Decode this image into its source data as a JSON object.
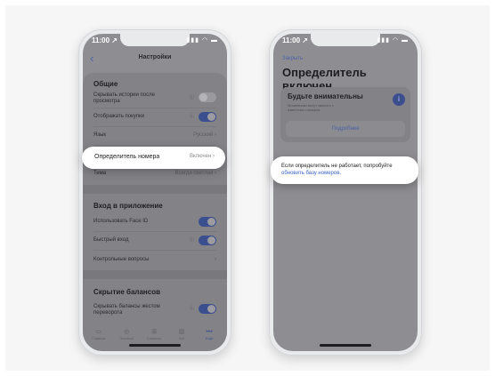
{
  "phone_left": {
    "status": {
      "time": "11:00 ↗",
      "icons": "▮▮▮ ◠ ▬"
    },
    "nav": {
      "back_icon": "chevron-left",
      "title": "Настройки"
    },
    "sections": {
      "general": {
        "title": "Общие",
        "hide_stories": "Скрывать истории после просмотра",
        "show_purchases": "Отображать покупки",
        "language_label": "Язык",
        "language_value": "Русский",
        "caller_id_label": "Определитель номера",
        "caller_id_value": "Включен",
        "theme_label": "Тема",
        "theme_value": "Всегда светлая"
      },
      "login": {
        "title": "Вход в приложение",
        "face_id": "Использовать Face ID",
        "quick_login": "Быстрый вход",
        "security_questions": "Контрольные вопросы"
      },
      "hidden_balances": {
        "title": "Скрытие балансов",
        "hide_by_flip": "Скрывать балансы жестом переворота"
      }
    },
    "toggles": {
      "hide_stories": false,
      "show_purchases": true,
      "face_id": true,
      "quick_login": true,
      "hide_by_flip": true
    },
    "tabbar": [
      {
        "label": "Главная",
        "icon": "home-icon"
      },
      {
        "label": "Платежи",
        "icon": "payments-icon"
      },
      {
        "label": "Сервисы",
        "icon": "services-icon"
      },
      {
        "label": "Чат",
        "icon": "chat-icon"
      },
      {
        "label": "Ещё",
        "icon": "more-icon"
      }
    ]
  },
  "phone_right": {
    "status": {
      "time": "11:00 ↗",
      "icons": "▮▮▮ ◠ ▬"
    },
    "close": "Закрыть",
    "title": "Определитель включен",
    "warning": {
      "title": "Будьте внимательны",
      "subtitle": "Мошенники могут звонить с известных номеров",
      "icon": "info-icon",
      "button": "Подробнее"
    },
    "callout": {
      "text": "Если определитель не работает, попробуйте",
      "link": "обновить базу номеров."
    }
  },
  "colors": {
    "accent": "#3b4f8e",
    "link": "#3d63c8",
    "overlay": "#8e8e92"
  }
}
